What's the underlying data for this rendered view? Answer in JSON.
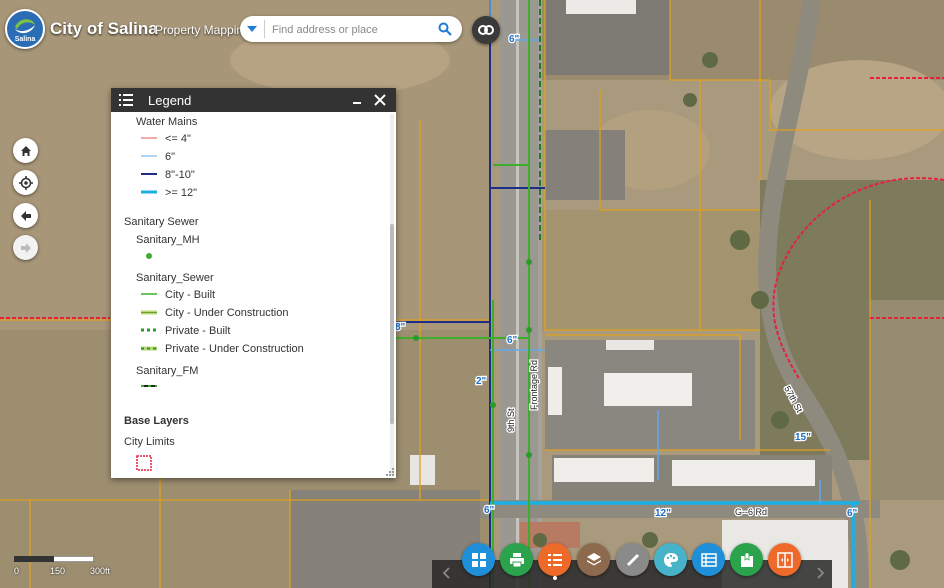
{
  "header": {
    "logo_text": "Salina",
    "title": "City of Salina",
    "subtitle": "Property Mapping",
    "search_placeholder": "Find address or place"
  },
  "legend": {
    "title": "Legend",
    "water_mains": {
      "heading": "Water Mains",
      "items": [
        {
          "label": "<= 4\"",
          "color": "#e25b4b"
        },
        {
          "label": "6\"",
          "color": "#62a8e8"
        },
        {
          "label": "8\"-10\"",
          "color": "#1e2d86"
        },
        {
          "label": ">= 12\"",
          "color": "#1ab0e4"
        }
      ]
    },
    "sanitary_sewer": {
      "heading": "Sanitary Sewer",
      "mh_label": "Sanitary_MH",
      "sewer_label": "Sanitary_Sewer",
      "sewer_items": [
        {
          "label": "City - Built"
        },
        {
          "label": "City - Under Construction"
        },
        {
          "label": "Private - Built"
        },
        {
          "label": "Private - Under Construction"
        }
      ],
      "fm_label": "Sanitary_FM"
    },
    "base_layers": {
      "heading": "Base Layers",
      "city_limits": "City Limits"
    }
  },
  "map_labels": {
    "pipe_6_top": "6\"",
    "pipe_6_mid": "6\"",
    "pipe_6_bottom": "6\"",
    "pipe_8": "8\"",
    "pipe_2": "2\"",
    "pipe_12": "12\"",
    "pipe_15": "15\"",
    "pipe_6_right": "6\"",
    "street_9th": "9th St",
    "street_frontage": "Frontage Rd",
    "street_57th": "57th St",
    "street_gc": "G--6 Rd"
  },
  "scalebar": {
    "labels": [
      "0",
      "150",
      "300ft"
    ]
  },
  "toolbar": {
    "buttons": [
      {
        "name": "widgets",
        "color": "#1e8fd8"
      },
      {
        "name": "print",
        "color": "#2ba24c"
      },
      {
        "name": "legend",
        "color": "#ee6a2a"
      },
      {
        "name": "layers",
        "color": "#8d6a4e"
      },
      {
        "name": "measure",
        "color": "#8a8a8a"
      },
      {
        "name": "draw",
        "color": "#47b3c9"
      },
      {
        "name": "attribute-table",
        "color": "#1e8fd8"
      },
      {
        "name": "bookmark",
        "color": "#2ba24c"
      },
      {
        "name": "swipe",
        "color": "#ee6a2a"
      }
    ]
  }
}
